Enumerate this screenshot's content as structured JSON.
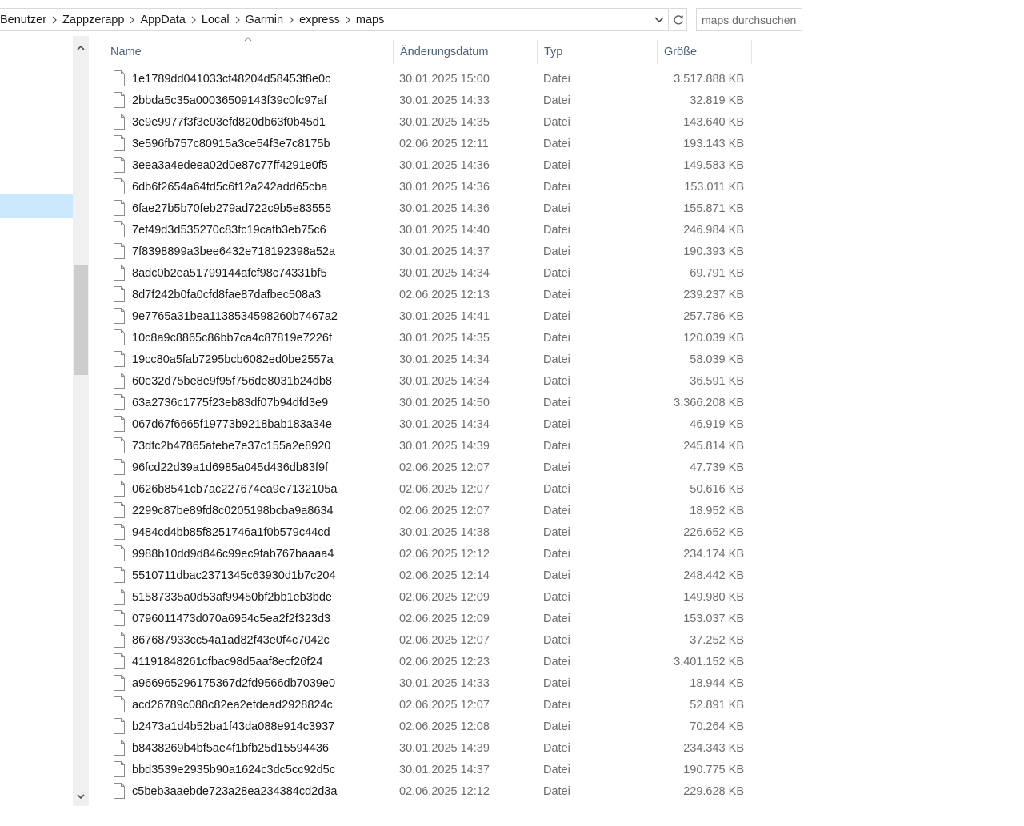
{
  "breadcrumb": [
    "Benutzer",
    "Zappzerapp",
    "AppData",
    "Local",
    "Garmin",
    "express",
    "maps"
  ],
  "search": {
    "placeholder": "maps durchsuchen"
  },
  "columns": {
    "name": "Name",
    "date": "Änderungsdatum",
    "type": "Typ",
    "size": "Größe"
  },
  "files": [
    {
      "name": "1e1789dd041033cf48204d58453f8e0c",
      "date": "30.01.2025 15:00",
      "type": "Datei",
      "size": "3.517.888 KB"
    },
    {
      "name": "2bbda5c35a00036509143f39c0fc97af",
      "date": "30.01.2025 14:33",
      "type": "Datei",
      "size": "32.819 KB"
    },
    {
      "name": "3e9e9977f3f3e03efd820db63f0b45d1",
      "date": "30.01.2025 14:35",
      "type": "Datei",
      "size": "143.640 KB"
    },
    {
      "name": "3e596fb757c80915a3ce54f3e7c8175b",
      "date": "02.06.2025 12:11",
      "type": "Datei",
      "size": "193.143 KB"
    },
    {
      "name": "3eea3a4edeea02d0e87c77ff4291e0f5",
      "date": "30.01.2025 14:36",
      "type": "Datei",
      "size": "149.583 KB"
    },
    {
      "name": "6db6f2654a64fd5c6f12a242add65cba",
      "date": "30.01.2025 14:36",
      "type": "Datei",
      "size": "153.011 KB"
    },
    {
      "name": "6fae27b5b70feb279ad722c9b5e83555",
      "date": "30.01.2025 14:36",
      "type": "Datei",
      "size": "155.871 KB"
    },
    {
      "name": "7ef49d3d535270c83fc19cafb3eb75c6",
      "date": "30.01.2025 14:40",
      "type": "Datei",
      "size": "246.984 KB"
    },
    {
      "name": "7f8398899a3bee6432e718192398a52a",
      "date": "30.01.2025 14:37",
      "type": "Datei",
      "size": "190.393 KB"
    },
    {
      "name": "8adc0b2ea51799144afcf98c74331bf5",
      "date": "30.01.2025 14:34",
      "type": "Datei",
      "size": "69.791 KB"
    },
    {
      "name": "8d7f242b0fa0cfd8fae87dafbec508a3",
      "date": "02.06.2025 12:13",
      "type": "Datei",
      "size": "239.237 KB"
    },
    {
      "name": "9e7765a31bea1138534598260b7467a2",
      "date": "30.01.2025 14:41",
      "type": "Datei",
      "size": "257.786 KB"
    },
    {
      "name": "10c8a9c8865c86bb7ca4c87819e7226f",
      "date": "30.01.2025 14:35",
      "type": "Datei",
      "size": "120.039 KB"
    },
    {
      "name": "19cc80a5fab7295bcb6082ed0be2557a",
      "date": "30.01.2025 14:34",
      "type": "Datei",
      "size": "58.039 KB"
    },
    {
      "name": "60e32d75be8e9f95f756de8031b24db8",
      "date": "30.01.2025 14:34",
      "type": "Datei",
      "size": "36.591 KB"
    },
    {
      "name": "63a2736c1775f23eb83df07b94dfd3e9",
      "date": "30.01.2025 14:50",
      "type": "Datei",
      "size": "3.366.208 KB"
    },
    {
      "name": "067d67f6665f19773b9218bab183a34e",
      "date": "30.01.2025 14:34",
      "type": "Datei",
      "size": "46.919 KB"
    },
    {
      "name": "73dfc2b47865afebe7e37c155a2e8920",
      "date": "30.01.2025 14:39",
      "type": "Datei",
      "size": "245.814 KB"
    },
    {
      "name": "96fcd22d39a1d6985a045d436db83f9f",
      "date": "02.06.2025 12:07",
      "type": "Datei",
      "size": "47.739 KB"
    },
    {
      "name": "0626b8541cb7ac227674ea9e7132105a",
      "date": "02.06.2025 12:07",
      "type": "Datei",
      "size": "50.616 KB"
    },
    {
      "name": "2299c87be89fd8c0205198bcba9a8634",
      "date": "02.06.2025 12:07",
      "type": "Datei",
      "size": "18.952 KB"
    },
    {
      "name": "9484cd4bb85f8251746a1f0b579c44cd",
      "date": "30.01.2025 14:38",
      "type": "Datei",
      "size": "226.652 KB"
    },
    {
      "name": "9988b10dd9d846c99ec9fab767baaaa4",
      "date": "02.06.2025 12:12",
      "type": "Datei",
      "size": "234.174 KB"
    },
    {
      "name": "5510711dbac2371345c63930d1b7c204",
      "date": "02.06.2025 12:14",
      "type": "Datei",
      "size": "248.442 KB"
    },
    {
      "name": "51587335a0d53af99450bf2bb1eb3bde",
      "date": "02.06.2025 12:09",
      "type": "Datei",
      "size": "149.980 KB"
    },
    {
      "name": "0796011473d070a6954c5ea2f2f323d3",
      "date": "02.06.2025 12:09",
      "type": "Datei",
      "size": "153.037 KB"
    },
    {
      "name": "867687933cc54a1ad82f43e0f4c7042c",
      "date": "02.06.2025 12:07",
      "type": "Datei",
      "size": "37.252 KB"
    },
    {
      "name": "41191848261cfbac98d5aaf8ecf26f24",
      "date": "02.06.2025 12:23",
      "type": "Datei",
      "size": "3.401.152 KB"
    },
    {
      "name": "a966965296175367d2fd9566db7039e0",
      "date": "30.01.2025 14:33",
      "type": "Datei",
      "size": "18.944 KB"
    },
    {
      "name": "acd26789c088c82ea2efdead2928824c",
      "date": "02.06.2025 12:07",
      "type": "Datei",
      "size": "52.891 KB"
    },
    {
      "name": "b2473a1d4b52ba1f43da088e914c3937",
      "date": "02.06.2025 12:08",
      "type": "Datei",
      "size": "70.264 KB"
    },
    {
      "name": "b8438269b4bf5ae4f1bfb25d15594436",
      "date": "30.01.2025 14:39",
      "type": "Datei",
      "size": "234.343 KB"
    },
    {
      "name": "bbd3539e2935b90a1624c3dc5cc92d5c",
      "date": "30.01.2025 14:37",
      "type": "Datei",
      "size": "190.775 KB"
    },
    {
      "name": "c5beb3aaebde723a28ea234384cd2d3a",
      "date": "02.06.2025 12:12",
      "type": "Datei",
      "size": "229.628 KB"
    }
  ],
  "icons": {
    "file": "file-icon",
    "separator": "chevron-right-icon",
    "dropdown": "chevron-down-icon",
    "refresh": "refresh-icon",
    "sort": "sort-ascending-icon",
    "scroll_up": "scroll-up-arrow-icon",
    "scroll_down": "scroll-down-arrow-icon"
  },
  "colors": {
    "header_text": "#4c607a",
    "meta_text": "#6d6d6d",
    "selection": "#cce8ff"
  }
}
